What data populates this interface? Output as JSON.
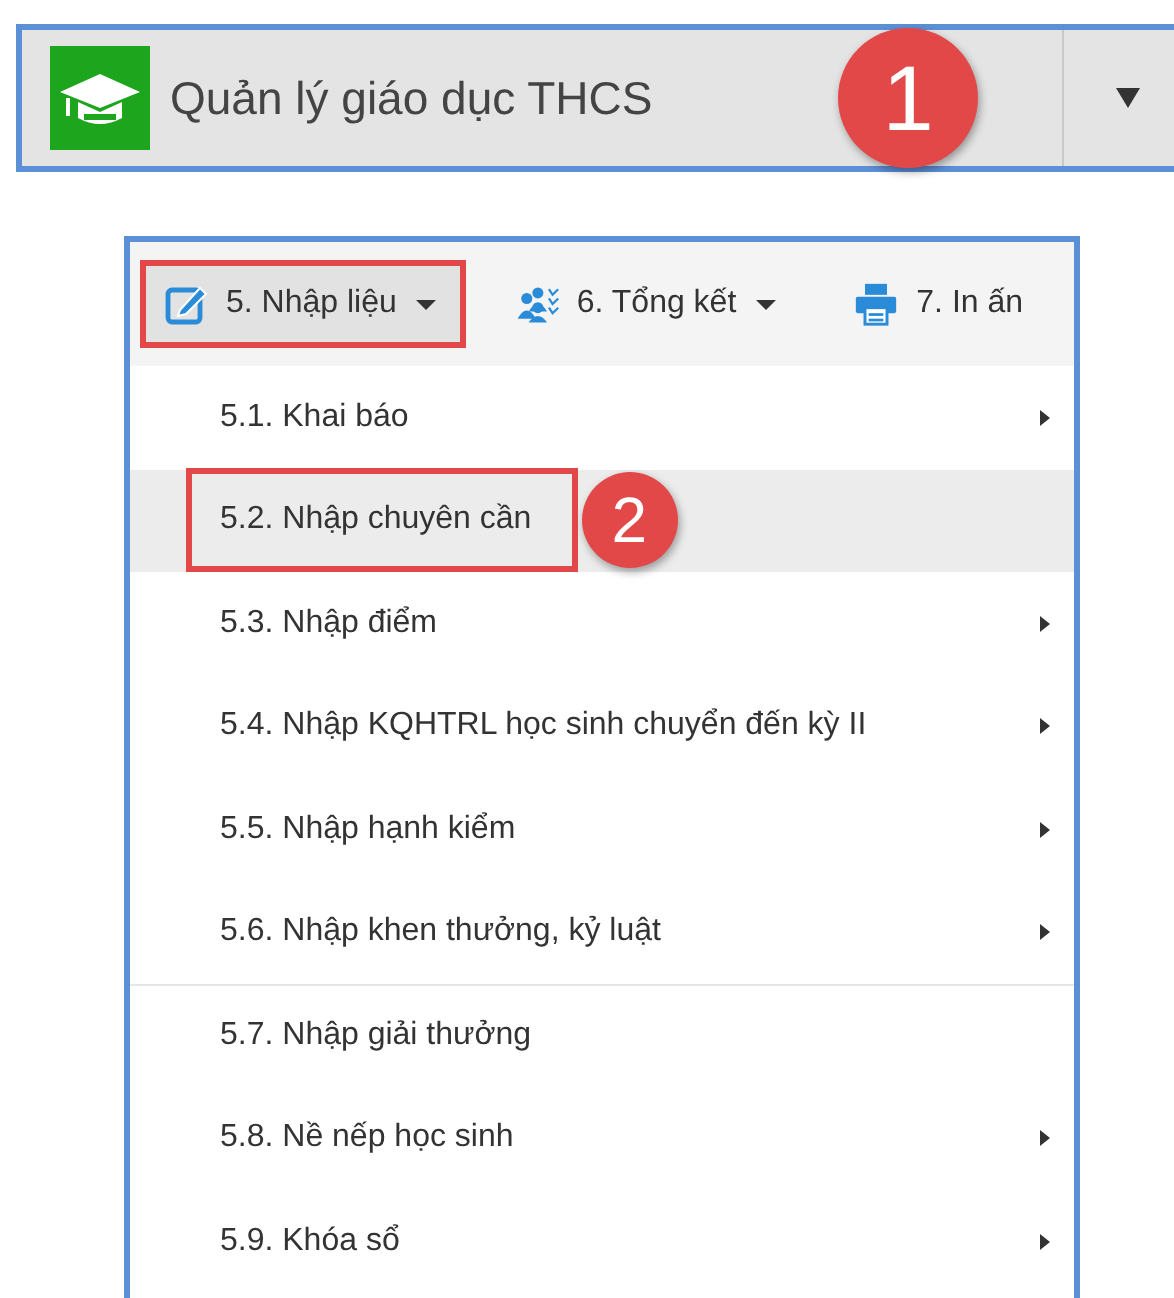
{
  "header": {
    "title": "Quản lý giáo dục THCS",
    "badge": "1"
  },
  "menubar": [
    {
      "label": "5. Nhập liệu",
      "kind": "edit",
      "caret": true,
      "selected": true,
      "outlined": true
    },
    {
      "label": "6. Tổng kết",
      "kind": "people",
      "caret": true,
      "selected": false,
      "outlined": false
    },
    {
      "label": "7. In ấn",
      "kind": "printer",
      "caret": false,
      "selected": false,
      "outlined": false
    }
  ],
  "menu_items": [
    {
      "label": "5.1. Khai báo",
      "submenu": true,
      "selected": false,
      "outlined": false,
      "separator_above": false
    },
    {
      "label": "5.2. Nhập chuyên cần",
      "submenu": false,
      "selected": true,
      "outlined": true,
      "badge": "2",
      "separator_above": false
    },
    {
      "label": "5.3. Nhập điểm",
      "submenu": true,
      "selected": false,
      "outlined": false,
      "separator_above": false
    },
    {
      "label": "5.4. Nhập KQHTRL học sinh chuyển đến kỳ II",
      "submenu": true,
      "selected": false,
      "outlined": false,
      "separator_above": false
    },
    {
      "label": "5.5. Nhập hạnh kiểm",
      "submenu": true,
      "selected": false,
      "outlined": false,
      "separator_above": false
    },
    {
      "label": "5.6. Nhập khen thưởng, kỷ luật",
      "submenu": true,
      "selected": false,
      "outlined": false,
      "separator_above": false
    },
    {
      "label": "5.7. Nhập giải thưởng",
      "submenu": false,
      "selected": false,
      "outlined": false,
      "separator_above": true
    },
    {
      "label": "5.8. Nề nếp học sinh",
      "submenu": true,
      "selected": false,
      "outlined": false,
      "separator_above": false
    },
    {
      "label": "5.9. Khóa sổ",
      "submenu": true,
      "selected": false,
      "outlined": false,
      "separator_above": false
    }
  ]
}
